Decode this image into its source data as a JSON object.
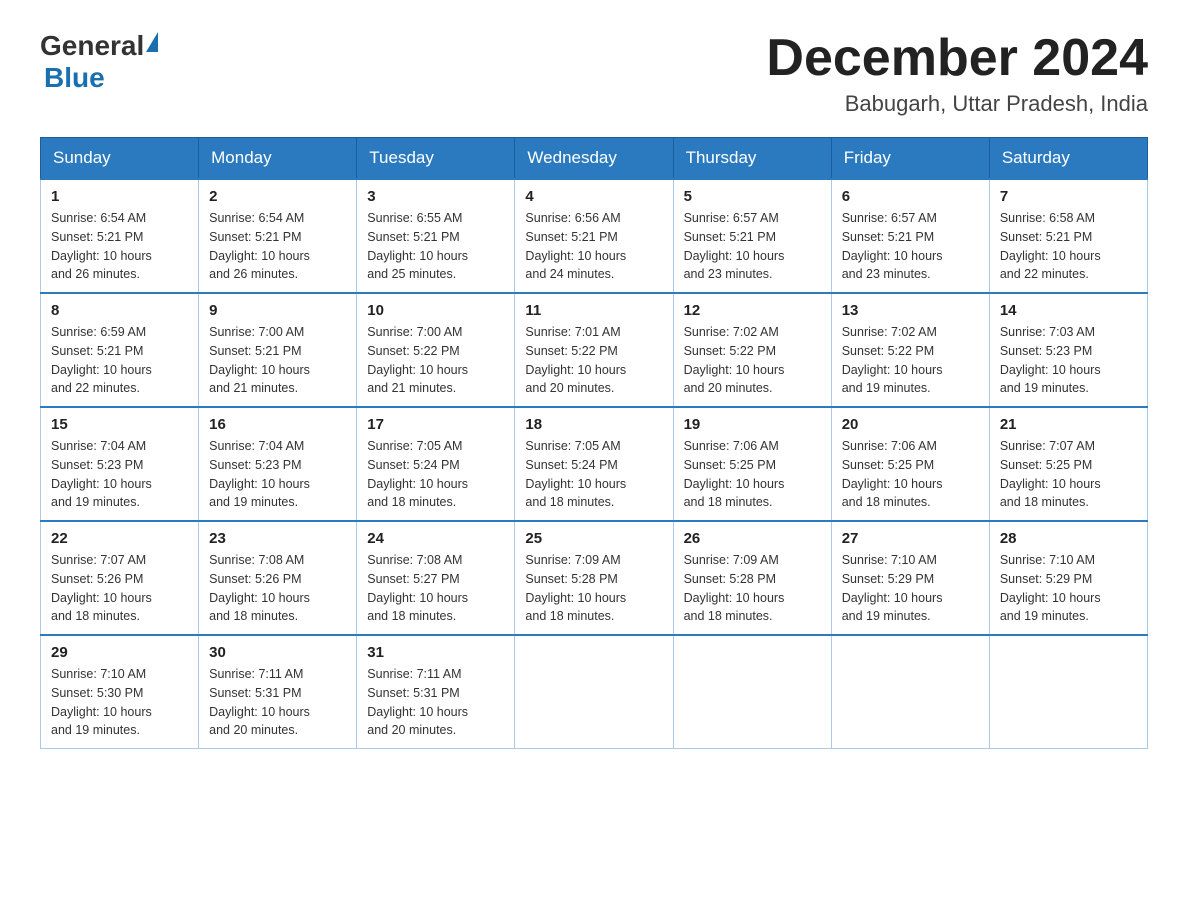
{
  "header": {
    "logo_general": "General",
    "logo_blue": "Blue",
    "main_title": "December 2024",
    "subtitle": "Babugarh, Uttar Pradesh, India"
  },
  "calendar": {
    "days": [
      "Sunday",
      "Monday",
      "Tuesday",
      "Wednesday",
      "Thursday",
      "Friday",
      "Saturday"
    ],
    "weeks": [
      [
        {
          "day": "1",
          "info": "Sunrise: 6:54 AM\nSunset: 5:21 PM\nDaylight: 10 hours\nand 26 minutes."
        },
        {
          "day": "2",
          "info": "Sunrise: 6:54 AM\nSunset: 5:21 PM\nDaylight: 10 hours\nand 26 minutes."
        },
        {
          "day": "3",
          "info": "Sunrise: 6:55 AM\nSunset: 5:21 PM\nDaylight: 10 hours\nand 25 minutes."
        },
        {
          "day": "4",
          "info": "Sunrise: 6:56 AM\nSunset: 5:21 PM\nDaylight: 10 hours\nand 24 minutes."
        },
        {
          "day": "5",
          "info": "Sunrise: 6:57 AM\nSunset: 5:21 PM\nDaylight: 10 hours\nand 23 minutes."
        },
        {
          "day": "6",
          "info": "Sunrise: 6:57 AM\nSunset: 5:21 PM\nDaylight: 10 hours\nand 23 minutes."
        },
        {
          "day": "7",
          "info": "Sunrise: 6:58 AM\nSunset: 5:21 PM\nDaylight: 10 hours\nand 22 minutes."
        }
      ],
      [
        {
          "day": "8",
          "info": "Sunrise: 6:59 AM\nSunset: 5:21 PM\nDaylight: 10 hours\nand 22 minutes."
        },
        {
          "day": "9",
          "info": "Sunrise: 7:00 AM\nSunset: 5:21 PM\nDaylight: 10 hours\nand 21 minutes."
        },
        {
          "day": "10",
          "info": "Sunrise: 7:00 AM\nSunset: 5:22 PM\nDaylight: 10 hours\nand 21 minutes."
        },
        {
          "day": "11",
          "info": "Sunrise: 7:01 AM\nSunset: 5:22 PM\nDaylight: 10 hours\nand 20 minutes."
        },
        {
          "day": "12",
          "info": "Sunrise: 7:02 AM\nSunset: 5:22 PM\nDaylight: 10 hours\nand 20 minutes."
        },
        {
          "day": "13",
          "info": "Sunrise: 7:02 AM\nSunset: 5:22 PM\nDaylight: 10 hours\nand 19 minutes."
        },
        {
          "day": "14",
          "info": "Sunrise: 7:03 AM\nSunset: 5:23 PM\nDaylight: 10 hours\nand 19 minutes."
        }
      ],
      [
        {
          "day": "15",
          "info": "Sunrise: 7:04 AM\nSunset: 5:23 PM\nDaylight: 10 hours\nand 19 minutes."
        },
        {
          "day": "16",
          "info": "Sunrise: 7:04 AM\nSunset: 5:23 PM\nDaylight: 10 hours\nand 19 minutes."
        },
        {
          "day": "17",
          "info": "Sunrise: 7:05 AM\nSunset: 5:24 PM\nDaylight: 10 hours\nand 18 minutes."
        },
        {
          "day": "18",
          "info": "Sunrise: 7:05 AM\nSunset: 5:24 PM\nDaylight: 10 hours\nand 18 minutes."
        },
        {
          "day": "19",
          "info": "Sunrise: 7:06 AM\nSunset: 5:25 PM\nDaylight: 10 hours\nand 18 minutes."
        },
        {
          "day": "20",
          "info": "Sunrise: 7:06 AM\nSunset: 5:25 PM\nDaylight: 10 hours\nand 18 minutes."
        },
        {
          "day": "21",
          "info": "Sunrise: 7:07 AM\nSunset: 5:25 PM\nDaylight: 10 hours\nand 18 minutes."
        }
      ],
      [
        {
          "day": "22",
          "info": "Sunrise: 7:07 AM\nSunset: 5:26 PM\nDaylight: 10 hours\nand 18 minutes."
        },
        {
          "day": "23",
          "info": "Sunrise: 7:08 AM\nSunset: 5:26 PM\nDaylight: 10 hours\nand 18 minutes."
        },
        {
          "day": "24",
          "info": "Sunrise: 7:08 AM\nSunset: 5:27 PM\nDaylight: 10 hours\nand 18 minutes."
        },
        {
          "day": "25",
          "info": "Sunrise: 7:09 AM\nSunset: 5:28 PM\nDaylight: 10 hours\nand 18 minutes."
        },
        {
          "day": "26",
          "info": "Sunrise: 7:09 AM\nSunset: 5:28 PM\nDaylight: 10 hours\nand 18 minutes."
        },
        {
          "day": "27",
          "info": "Sunrise: 7:10 AM\nSunset: 5:29 PM\nDaylight: 10 hours\nand 19 minutes."
        },
        {
          "day": "28",
          "info": "Sunrise: 7:10 AM\nSunset: 5:29 PM\nDaylight: 10 hours\nand 19 minutes."
        }
      ],
      [
        {
          "day": "29",
          "info": "Sunrise: 7:10 AM\nSunset: 5:30 PM\nDaylight: 10 hours\nand 19 minutes."
        },
        {
          "day": "30",
          "info": "Sunrise: 7:11 AM\nSunset: 5:31 PM\nDaylight: 10 hours\nand 20 minutes."
        },
        {
          "day": "31",
          "info": "Sunrise: 7:11 AM\nSunset: 5:31 PM\nDaylight: 10 hours\nand 20 minutes."
        },
        null,
        null,
        null,
        null
      ]
    ]
  }
}
